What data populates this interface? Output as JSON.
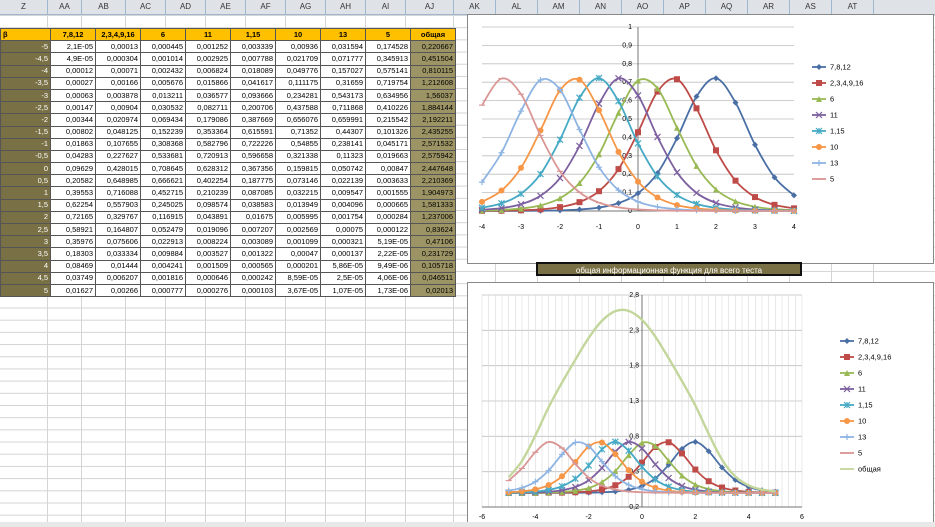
{
  "column_headers": [
    "Z",
    "AA",
    "AB",
    "AC",
    "AD",
    "AE",
    "AF",
    "AG",
    "AH",
    "AI",
    "AJ",
    "AK",
    "AL",
    "AM",
    "AN",
    "AO",
    "AP",
    "AQ",
    "AR",
    "AS",
    "AT"
  ],
  "table": {
    "headers": [
      "β",
      "7,8,12",
      "2,3,4,9,16",
      "6",
      "11",
      "1,15",
      "10",
      "13",
      "5",
      "общая"
    ],
    "rows": [
      [
        "-5",
        "2,1E-05",
        "0,00013",
        "0,000445",
        "0,001252",
        "0,003339",
        "0,00936",
        "0,031594",
        "0,174528",
        "0,220667"
      ],
      [
        "-4,5",
        "4,9E-05",
        "0,000304",
        "0,001014",
        "0,002925",
        "0,007788",
        "0,021709",
        "0,071777",
        "0,345913",
        "0,451504"
      ],
      [
        "-4",
        "0,00012",
        "0,00071",
        "0,002432",
        "0,006824",
        "0,018089",
        "0,049776",
        "0,157027",
        "0,575141",
        "0,810115"
      ],
      [
        "-3,5",
        "0,00027",
        "0,00166",
        "0,005676",
        "0,015866",
        "0,041617",
        "0,111175",
        "0,31659",
        "0,719754",
        "1,212608"
      ],
      [
        "-3",
        "0,00063",
        "0,003878",
        "0,013211",
        "0,036577",
        "0,093666",
        "0,234281",
        "0,543173",
        "0,634956",
        "1,56037"
      ],
      [
        "-2,5",
        "0,00147",
        "0,00904",
        "0,030532",
        "0,082711",
        "0,200706",
        "0,437588",
        "0,711868",
        "0,410226",
        "1,884144"
      ],
      [
        "-2",
        "0,00344",
        "0,020974",
        "0,069434",
        "0,179086",
        "0,387669",
        "0,656076",
        "0,659991",
        "0,215542",
        "2,192211"
      ],
      [
        "-1,5",
        "0,00802",
        "0,048125",
        "0,152239",
        "0,353364",
        "0,615591",
        "0,71352",
        "0,44307",
        "0,101326",
        "2,435255"
      ],
      [
        "-1",
        "0,01863",
        "0,107655",
        "0,308368",
        "0,582796",
        "0,722226",
        "0,54855",
        "0,238141",
        "0,045171",
        "2,571532"
      ],
      [
        "-0,5",
        "0,04283",
        "0,227627",
        "0,533681",
        "0,720913",
        "0,596658",
        "0,321338",
        "0,11323",
        "0,019663",
        "2,575942"
      ],
      [
        "0",
        "0,09629",
        "0,428015",
        "0,708645",
        "0,628312",
        "0,367356",
        "0,159815",
        "0,050742",
        "0,00847",
        "2,447648"
      ],
      [
        "0,5",
        "0,20582",
        "0,648985",
        "0,666621",
        "0,402254",
        "0,187775",
        "0,073146",
        "0,022139",
        "0,003633",
        "2,210369"
      ],
      [
        "1",
        "0,39553",
        "0,716088",
        "0,452715",
        "0,210239",
        "0,087085",
        "0,032215",
        "0,009547",
        "0,001555",
        "1,904973"
      ],
      [
        "1,5",
        "0,62254",
        "0,557903",
        "0,245025",
        "0,098574",
        "0,038583",
        "0,013949",
        "0,004096",
        "0,000665",
        "1,581333"
      ],
      [
        "2",
        "0,72165",
        "0,329767",
        "0,116915",
        "0,043891",
        "0,01675",
        "0,005995",
        "0,001754",
        "0,000284",
        "1,237006"
      ],
      [
        "2,5",
        "0,58921",
        "0,164807",
        "0,052479",
        "0,019096",
        "0,007207",
        "0,002569",
        "0,00075",
        "0,000122",
        "0,83624"
      ],
      [
        "3",
        "0,35976",
        "0,075606",
        "0,022913",
        "0,008224",
        "0,003089",
        "0,001099",
        "0,000321",
        "5,19E-05",
        "0,47106"
      ],
      [
        "3,5",
        "0,18303",
        "0,033334",
        "0,009884",
        "0,003527",
        "0,001322",
        "0,00047",
        "0,000137",
        "2,22E-05",
        "0,231729"
      ],
      [
        "4",
        "0,08469",
        "0,01444",
        "0,004241",
        "0,001509",
        "0,000565",
        "0,000201",
        "5,86E-05",
        "9,49E-06",
        "0,105718"
      ],
      [
        "4,5",
        "0,03749",
        "0,006207",
        "0,001816",
        "0,000646",
        "0,000242",
        "8,59E-05",
        "2,5E-05",
        "4,06E-06",
        "0,046511"
      ],
      [
        "5",
        "0,01627",
        "0,00266",
        "0,000777",
        "0,000276",
        "0,000103",
        "3,67E-05",
        "1,07E-05",
        "1,73E-06",
        "0,02013"
      ]
    ]
  },
  "chart_data": [
    {
      "type": "line",
      "x": [
        -5,
        -4.5,
        -4,
        -3.5,
        -3,
        -2.5,
        -2,
        -1.5,
        -1,
        -0.5,
        0,
        0.5,
        1,
        1.5,
        2,
        2.5,
        3,
        3.5,
        4,
        4.5,
        5
      ],
      "xlim": [
        -4,
        4
      ],
      "ylim": [
        0,
        1
      ],
      "x_ticks": [
        "-4",
        "-3",
        "-2",
        "-1",
        "0",
        "1",
        "2",
        "3",
        "4"
      ],
      "y_ticks": [
        "0",
        "0,1",
        "0,2",
        "0,3",
        "0,4",
        "0,5",
        "0,6",
        "0,7",
        "0,8",
        "0,9",
        "1"
      ],
      "grid": true,
      "legend": "right",
      "series": [
        {
          "name": "7,8,12",
          "color": "#4a6fa5",
          "marker": "diamond"
        },
        {
          "name": "2,3,4,9,16",
          "color": "#be4b48",
          "marker": "square"
        },
        {
          "name": "6",
          "color": "#98b954",
          "marker": "triangle"
        },
        {
          "name": "11",
          "color": "#7d60a0",
          "marker": "x"
        },
        {
          "name": "1,15",
          "color": "#46aac5",
          "marker": "star"
        },
        {
          "name": "10",
          "color": "#f79646",
          "marker": "circle"
        },
        {
          "name": "13",
          "color": "#8eb4e3",
          "marker": "plus"
        },
        {
          "name": "5",
          "color": "#d99694",
          "marker": "dash"
        }
      ]
    },
    {
      "type": "line",
      "title": "общая информационная функция для всего теста",
      "x": [
        -5,
        -4.5,
        -4,
        -3.5,
        -3,
        -2.5,
        -2,
        -1.5,
        -1,
        -0.5,
        0,
        0.5,
        1,
        1.5,
        2,
        2.5,
        3,
        3.5,
        4,
        4.5,
        5
      ],
      "xlim": [
        -6,
        6
      ],
      "ylim": [
        -0.2,
        2.8
      ],
      "x_ticks": [
        "-6",
        "-4",
        "-2",
        "0",
        "2",
        "4",
        "6"
      ],
      "y_ticks": [
        "-0,2",
        "0,3",
        "0,8",
        "1,3",
        "1,8",
        "2,3",
        "2,8"
      ],
      "grid": true,
      "legend": "right",
      "series": [
        {
          "name": "7,8,12",
          "color": "#4a6fa5",
          "marker": "diamond"
        },
        {
          "name": "2,3,4,9,16",
          "color": "#be4b48",
          "marker": "square"
        },
        {
          "name": "6",
          "color": "#98b954",
          "marker": "triangle"
        },
        {
          "name": "11",
          "color": "#7d60a0",
          "marker": "x"
        },
        {
          "name": "1,15",
          "color": "#46aac5",
          "marker": "star"
        },
        {
          "name": "10",
          "color": "#f79646",
          "marker": "circle"
        },
        {
          "name": "13",
          "color": "#8eb4e3",
          "marker": "plus"
        },
        {
          "name": "5",
          "color": "#d99694",
          "marker": "dash"
        },
        {
          "name": "общая",
          "color": "#c3d69b",
          "marker": "none"
        }
      ]
    }
  ]
}
